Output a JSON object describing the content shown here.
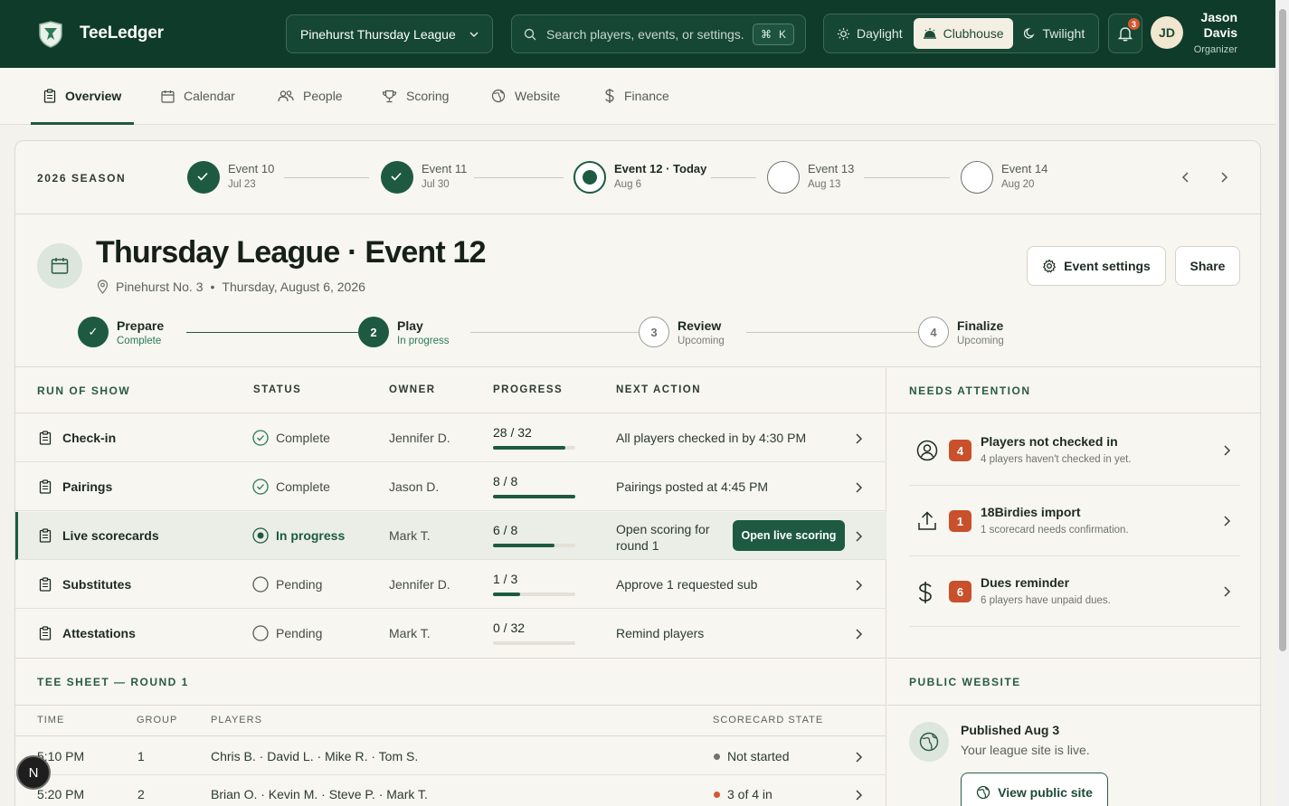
{
  "app": {
    "brand": "TeeLedger"
  },
  "header": {
    "league": "Pinehurst Thursday League",
    "search_placeholder": "Search players, events, or settings.",
    "shortcut_cmd": "⌘",
    "shortcut_key": "K",
    "themes": [
      {
        "label": "Daylight",
        "icon": "sun-icon",
        "active": false
      },
      {
        "label": "Clubhouse",
        "icon": "lamp-icon",
        "active": true
      },
      {
        "label": "Twilight",
        "icon": "moon-icon",
        "active": false
      }
    ],
    "notifications": "3",
    "user": {
      "initials": "JD",
      "first": "Jason",
      "last": "Davis",
      "role": "Organizer"
    }
  },
  "nav": [
    {
      "label": "Overview",
      "icon": "clipboard-icon",
      "active": true
    },
    {
      "label": "Calendar",
      "icon": "calendar-icon",
      "active": false
    },
    {
      "label": "People",
      "icon": "people-icon",
      "active": false
    },
    {
      "label": "Scoring",
      "icon": "trophy-icon",
      "active": false
    },
    {
      "label": "Website",
      "icon": "globe-icon",
      "active": false
    },
    {
      "label": "Finance",
      "icon": "dollar-icon",
      "active": false
    }
  ],
  "season": {
    "label": "2026 SEASON",
    "events": [
      {
        "title": "Event 10",
        "date": "Jul 23",
        "state": "done"
      },
      {
        "title": "Event 11",
        "date": "Jul 30",
        "state": "done"
      },
      {
        "title": "Event 12 · Today",
        "date": "Aug 6",
        "state": "today"
      },
      {
        "title": "Event 13",
        "date": "Aug 13",
        "state": "upcoming"
      },
      {
        "title": "Event 14",
        "date": "Aug 20",
        "state": "upcoming"
      }
    ]
  },
  "event": {
    "title": "Thursday League · Event 12",
    "course": "Pinehurst No. 3",
    "separator": "•",
    "date": "Thursday, August 6, 2026",
    "settings_label": "Event settings",
    "share_label": "Share",
    "phases": [
      {
        "num": "✓",
        "title": "Prepare",
        "status": "Complete",
        "state": "done"
      },
      {
        "num": "2",
        "title": "Play",
        "status": "In progress",
        "state": "current"
      },
      {
        "num": "3",
        "title": "Review",
        "status": "Upcoming",
        "state": "upcoming"
      },
      {
        "num": "4",
        "title": "Finalize",
        "status": "Upcoming",
        "state": "upcoming"
      }
    ]
  },
  "run_of_show": {
    "heading": "RUN OF SHOW",
    "columns": {
      "status": "STATUS",
      "owner": "OWNER",
      "progress": "PROGRESS",
      "next": "NEXT ACTION"
    },
    "rows": [
      {
        "name": "Check-in",
        "status": "Complete",
        "state": "complete",
        "owner": "Jennifer D.",
        "progress": "28 / 32",
        "fraction": 0.875,
        "next": "All players checked in by 4:30 PM"
      },
      {
        "name": "Pairings",
        "status": "Complete",
        "state": "complete",
        "owner": "Jason D.",
        "progress": "8 / 8",
        "fraction": 1.0,
        "next": "Pairings posted at 4:45 PM"
      },
      {
        "name": "Live scorecards",
        "status": "In progress",
        "state": "progress",
        "owner": "Mark T.",
        "progress": "6 / 8",
        "fraction": 0.75,
        "next": "Open scoring for round 1",
        "action": "Open live scoring"
      },
      {
        "name": "Substitutes",
        "status": "Pending",
        "state": "pending",
        "owner": "Jennifer D.",
        "progress": "1 / 3",
        "fraction": 0.333,
        "next": "Approve 1 requested sub"
      },
      {
        "name": "Attestations",
        "status": "Pending",
        "state": "pending",
        "owner": "Mark T.",
        "progress": "0 / 32",
        "fraction": 0,
        "next": "Remind players"
      }
    ]
  },
  "attention": {
    "heading": "NEEDS ATTENTION",
    "items": [
      {
        "icon": "user-circle-icon",
        "count": "4",
        "title": "Players not checked in",
        "sub": "4 players haven't checked in yet."
      },
      {
        "icon": "upload-icon",
        "count": "1",
        "title": "18Birdies import",
        "sub": "1 scorecard needs confirmation."
      },
      {
        "icon": "dollar-icon",
        "count": "6",
        "title": "Dues reminder",
        "sub": "6 players have unpaid dues."
      }
    ]
  },
  "tee_sheet": {
    "heading": "TEE SHEET — ROUND 1",
    "columns": {
      "time": "TIME",
      "group": "GROUP",
      "players": "PLAYERS",
      "state": "SCORECARD STATE"
    },
    "rows": [
      {
        "time": "5:10 PM",
        "group": "1",
        "players": "Chris B. · David L. · Mike R. · Tom S.",
        "state": "Not started",
        "dot": "#6f746f"
      },
      {
        "time": "5:20 PM",
        "group": "2",
        "players": "Brian O. · Kevin M. · Steve P. · Mark T.",
        "state": "3 of 4 in",
        "dot": "#d4572e"
      }
    ]
  },
  "public_site": {
    "heading": "PUBLIC WEBSITE",
    "title": "Published Aug 3",
    "sub": "Your league site is live.",
    "button": "View public site"
  },
  "floating": {
    "label": "N"
  }
}
